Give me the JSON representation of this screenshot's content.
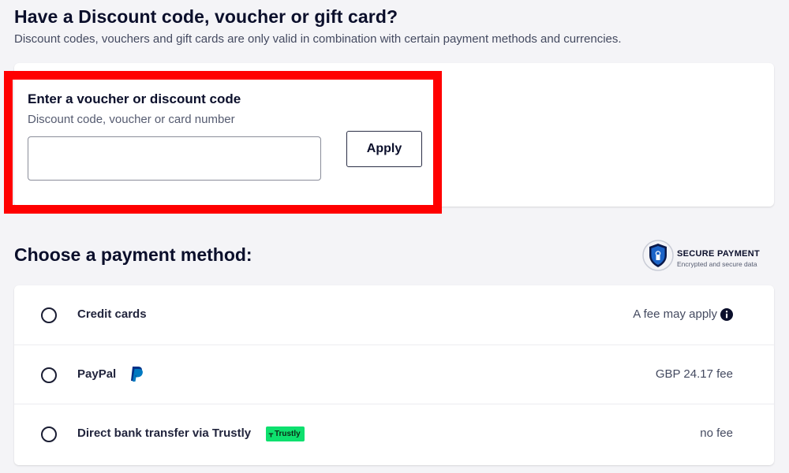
{
  "discount": {
    "title": "Have a Discount code, voucher or gift card?",
    "subtitle": "Discount codes, vouchers and gift cards are only valid in combination with certain payment methods and currencies.",
    "voucher_label": "Enter a voucher or discount code",
    "voucher_hint": "Discount code, voucher or card number",
    "input_value": "",
    "apply_label": "Apply"
  },
  "payment": {
    "title": "Choose a payment method:",
    "secure_badge": {
      "label": "SECURE PAYMENT",
      "sublabel": "Encrypted and secure data",
      "icon": "shield-lock-icon"
    },
    "methods": [
      {
        "name": "Credit cards",
        "fee": "A fee may apply",
        "icon": "info-icon"
      },
      {
        "name": "PayPal",
        "fee": "GBP 24.17 fee",
        "icon": "paypal-icon"
      },
      {
        "name": "Direct bank transfer via Trustly",
        "fee": "no fee",
        "badge": "Trustly",
        "icon": "trustly-logo-icon"
      }
    ]
  },
  "colors": {
    "highlight": "#ff0000",
    "text_dark": "#0b0f2b",
    "background": "#f4f4f7",
    "trustly_green": "#0ee06e",
    "paypal_blue": "#003087"
  }
}
